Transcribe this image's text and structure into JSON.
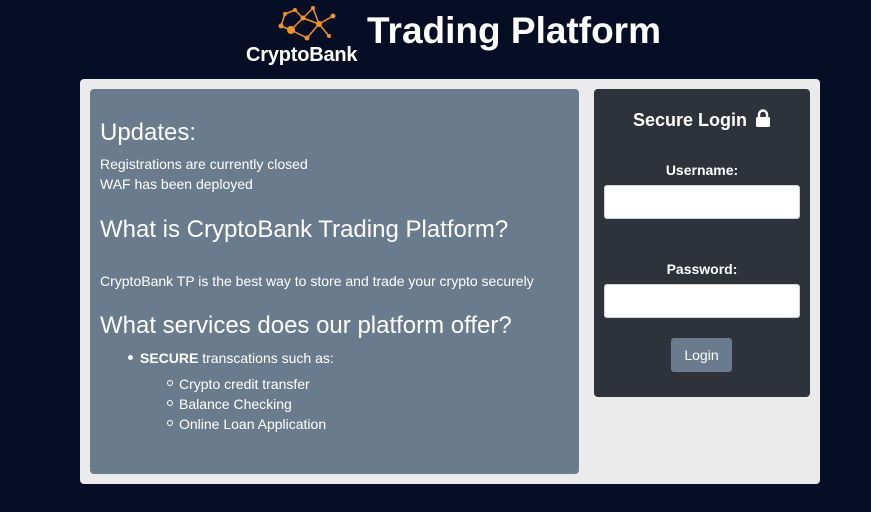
{
  "header": {
    "logo_text": "CryptoBank",
    "title": "Trading Platform",
    "logo_icon": "network-nodes-icon"
  },
  "info": {
    "updates_heading": "Updates:",
    "update_1": "Registrations are currently closed",
    "update_2": "WAF has been deployed",
    "about_heading": "What is CryptoBank Trading Platform?",
    "about_text": "CryptoBank TP is the best way to store and trade your crypto securely",
    "services_heading": "What services does our platform offer?",
    "services_bold": "SECURE",
    "services_text": " transcations such as:",
    "services": [
      "Crypto credit transfer",
      "Balance Checking",
      "Online Loan Application"
    ]
  },
  "login": {
    "title": "Secure Login",
    "title_icon": "lock-icon",
    "username_label": "Username:",
    "username_value": "",
    "password_label": "Password:",
    "password_value": "",
    "button_label": "Login"
  },
  "colors": {
    "background": "#060e25",
    "panel_blue": "#6a7b8e",
    "login_dark": "#2e333b",
    "logo_accent": "#f0922c"
  }
}
